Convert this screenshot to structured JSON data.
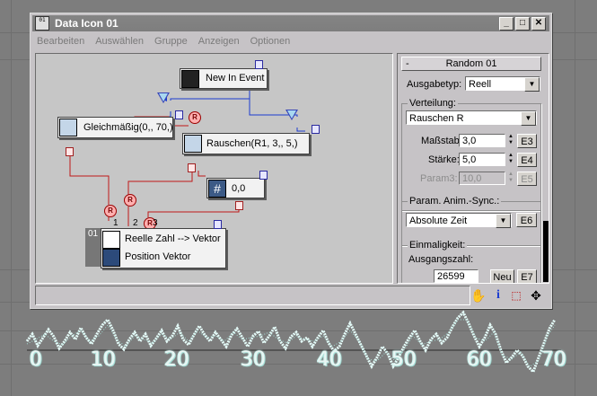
{
  "window": {
    "title": "Data Icon 01",
    "app_icon_text": "01",
    "minimize_label": "_",
    "maximize_label": "□",
    "close_label": "✕"
  },
  "menu": [
    "Bearbeiten",
    "Auswählen",
    "Gruppe",
    "Anzeigen",
    "Optionen"
  ],
  "graph": {
    "new_in_event": "New In Event",
    "gleichmassig": "Gleichmäßig(0,, 70,)",
    "rauschen": "Rauschen(R1, 3,, 5,)",
    "const_node": "0,0",
    "target_node_id": "01",
    "target_line1": "Reelle Zahl --> Vektor",
    "target_line2": "Position Vektor",
    "r_label": "R",
    "port_numbers": [
      "1",
      "2",
      "3"
    ]
  },
  "panel": {
    "rollout_minus": "-",
    "rollout_title": "Random 01",
    "ausgabetyp_label": "Ausgabetyp:",
    "ausgabetyp_value": "Reell",
    "verteilung_title": "Verteilung:",
    "verteilung_value": "Rauschen R",
    "massstab_label": "Maßstab:",
    "massstab_value": "3,0",
    "massstab_btn": "E3",
    "staerke_label": "Stärke:",
    "staerke_value": "5,0",
    "staerke_btn": "E4",
    "param3_label": "Param3:",
    "param3_value": "10,0",
    "param3_btn": "E5",
    "sync_title": "Param. Anim.-Sync.:",
    "sync_value": "Absolute Zeit",
    "sync_btn": "E6",
    "einmaligkeit_title": "Einmaligkeit:",
    "ausgangszahl_label": "Ausgangszahl:",
    "ausgangszahl_value": "26599",
    "neu_btn": "Neu",
    "e7_btn": "E7"
  },
  "toolbar_icons": [
    "hand-icon",
    "info-icon",
    "select-region-icon",
    "move-icon"
  ],
  "viewport": {
    "axis_labels": [
      "0",
      "10",
      "20",
      "30",
      "40",
      "50",
      "60",
      "70"
    ]
  },
  "colors": {
    "event_link": "#1c3cd0",
    "value_link": "#c01818",
    "particle_trail": "#e4fbf8"
  }
}
